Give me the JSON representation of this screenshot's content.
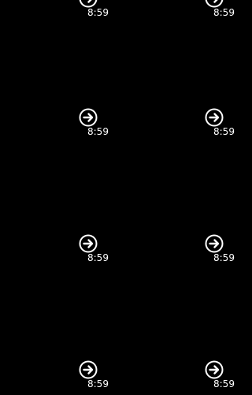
{
  "colors": {
    "background": "#000000",
    "foreground": "#ffffff"
  },
  "tiles": [
    {
      "time": "8:59",
      "icon": "arrow-right-circle-icon"
    },
    {
      "time": "8:59",
      "icon": "arrow-right-circle-icon"
    },
    {
      "time": "8:59",
      "icon": "arrow-right-circle-icon"
    },
    {
      "time": "8:59",
      "icon": "arrow-right-circle-icon"
    },
    {
      "time": "8:59",
      "icon": "arrow-right-circle-icon"
    },
    {
      "time": "8:59",
      "icon": "arrow-right-circle-icon"
    },
    {
      "time": "8:59",
      "icon": "arrow-right-circle-icon"
    },
    {
      "time": "8:59",
      "icon": "arrow-right-circle-icon"
    }
  ]
}
